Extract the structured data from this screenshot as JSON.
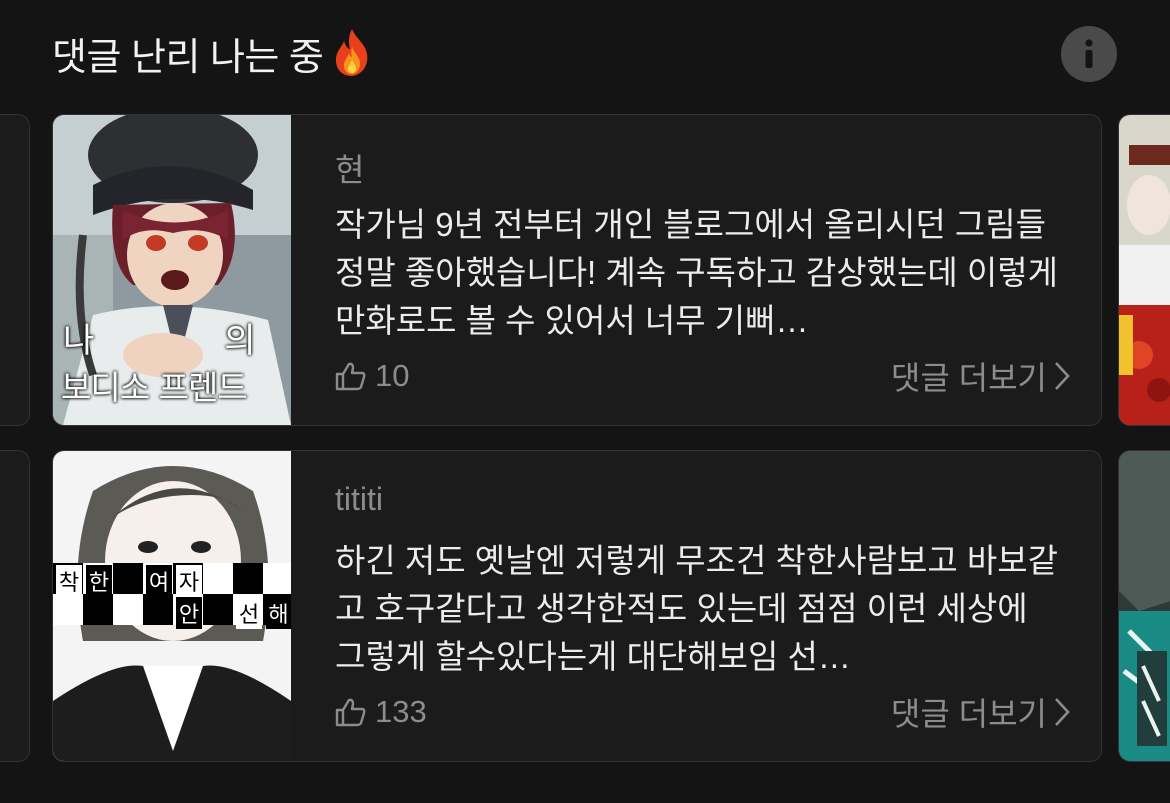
{
  "section": {
    "title": "댓글 난리 나는 중"
  },
  "cards": [
    {
      "thumb_text": [
        "나",
        "의",
        "보",
        "디",
        "소",
        "프",
        "렌",
        "드"
      ],
      "author": "현",
      "comment": "작가님 9년 전부터 개인 블로그에서 올리시던 그림들 정말 좋아했습니다! 계속 구독하고 감상했는데 이렇게 만화로도 볼 수 있어서 너무 기뻐…",
      "likes": "10",
      "more_label": "댓글 더보기"
    },
    {
      "thumb_text": [
        "착",
        "한",
        "여",
        "자",
        "안",
        "선",
        "해"
      ],
      "author": "tititi",
      "comment": "하긴 저도 옛날엔 저렇게 무조건 착한사람보고 바보같고 호구같다고 생각한적도 있는데 점점 이런 세상에 그렇게 할수있다는게 대단해보임 선…",
      "likes": "133",
      "more_label": "댓글 더보기"
    }
  ],
  "icons": {
    "fire": "fire-icon",
    "info": "info-icon",
    "like": "thumbs-up-icon",
    "chevron": "chevron-right-icon"
  },
  "colors": {
    "background": "#141414",
    "card": "#1b1b1b",
    "muted_text": "#8c8c8c",
    "info_button": "#4a4a4a"
  }
}
